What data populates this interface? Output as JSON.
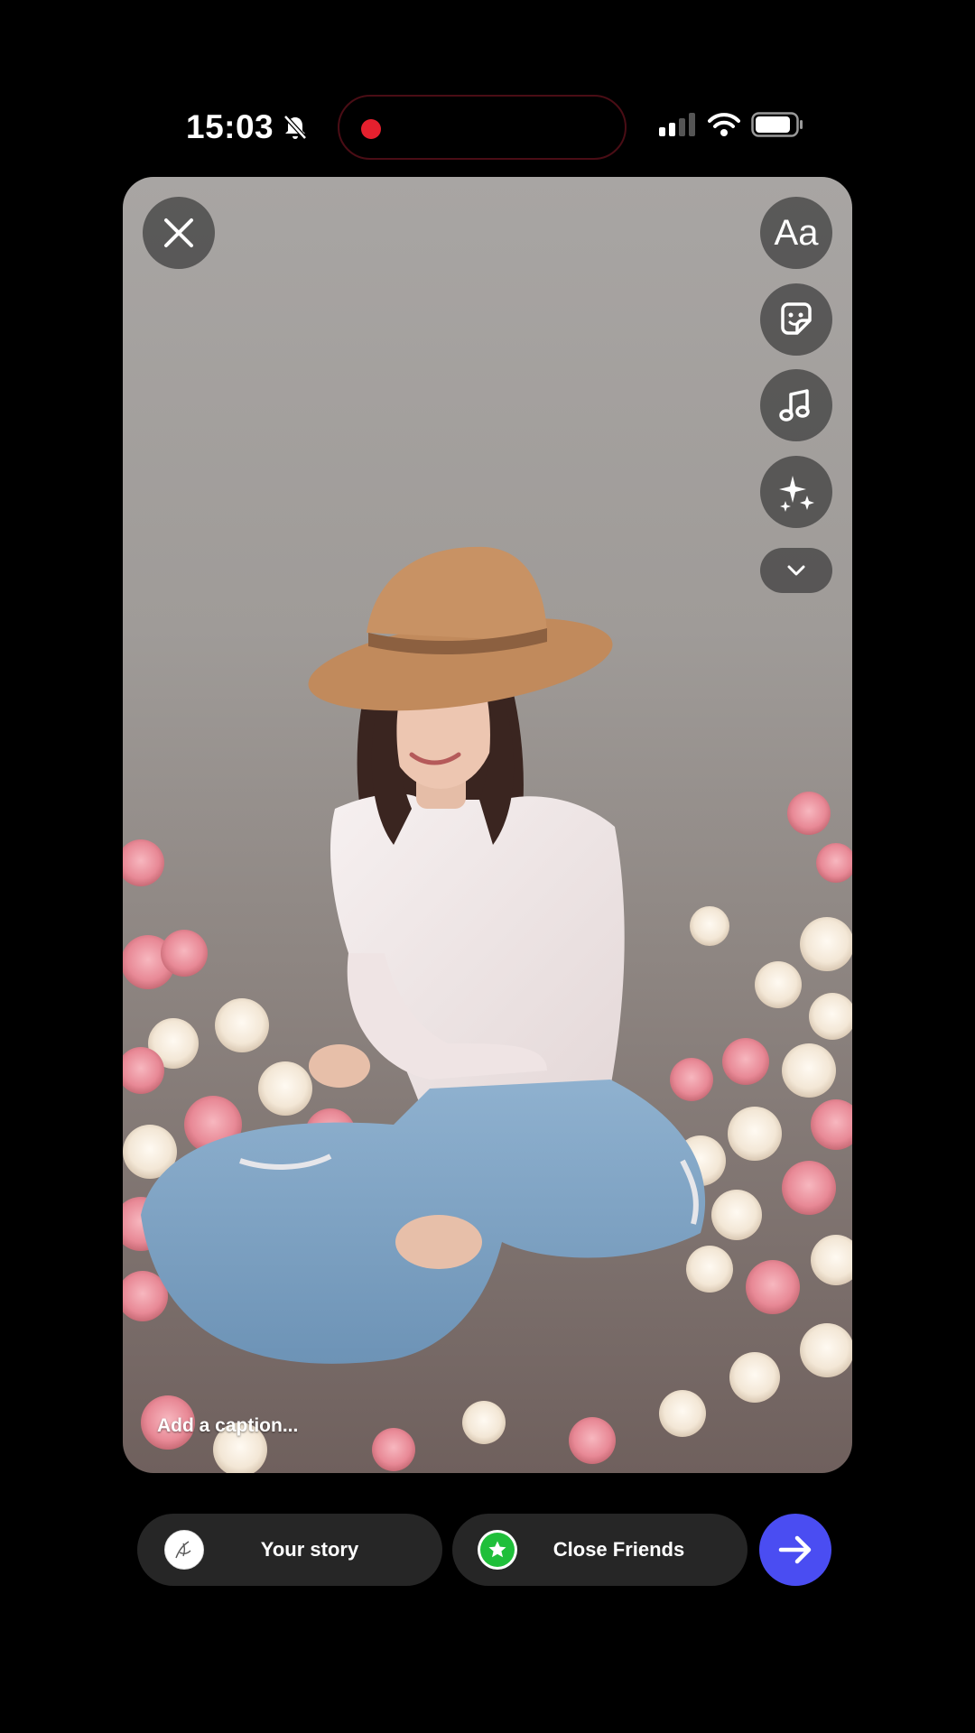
{
  "status_bar": {
    "time": "15:03",
    "recording": true,
    "signal_bars": 2,
    "battery_level": 0.85
  },
  "editor": {
    "text_tool_label": "Aa",
    "caption_placeholder": "Add a caption...",
    "tools": [
      "close-icon",
      "text-icon",
      "sticker-icon",
      "music-icon",
      "sparkles-icon",
      "chevron-down-icon"
    ]
  },
  "share_bar": {
    "your_story_label": "Your story",
    "close_friends_label": "Close Friends",
    "accent_color": "#4a4df2",
    "close_friends_color": "#1fbf3a"
  }
}
